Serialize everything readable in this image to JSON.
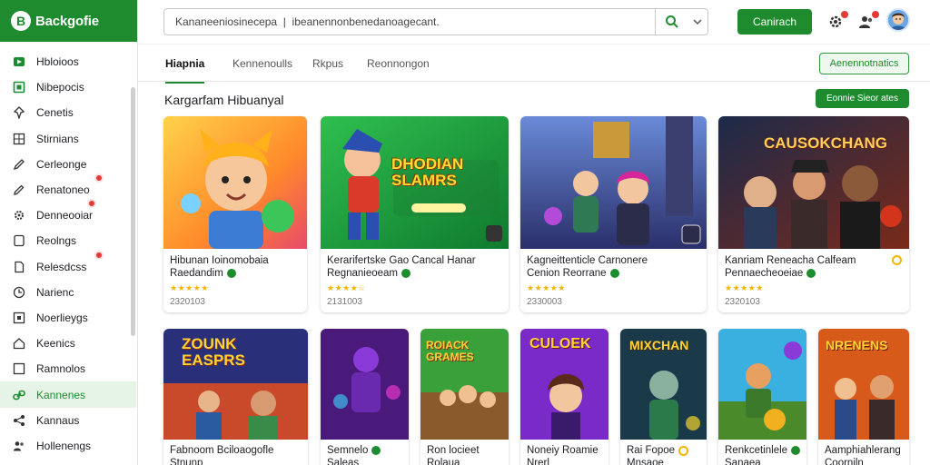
{
  "app": {
    "logo_text": "Backgofie",
    "logo_letter": "B"
  },
  "sidebar": {
    "items": [
      {
        "label": "Hbloioos",
        "icon": "play-icon",
        "active": false,
        "badge": false
      },
      {
        "label": "Nibepocis",
        "icon": "square-play-icon",
        "active": false,
        "badge": false
      },
      {
        "label": "Cenetis",
        "icon": "pin-icon",
        "active": false,
        "badge": false
      },
      {
        "label": "Stirnians",
        "icon": "grid-icon",
        "active": false,
        "badge": false
      },
      {
        "label": "Cerleonge",
        "icon": "pen-icon",
        "active": false,
        "badge": false
      },
      {
        "label": "Renatoneo",
        "icon": "edit-icon",
        "active": false,
        "badge": true
      },
      {
        "label": "Denneooiar",
        "icon": "gear-icon",
        "active": false,
        "badge": true
      },
      {
        "label": "Reolngs",
        "icon": "note-icon",
        "active": false,
        "badge": false
      },
      {
        "label": "Relesdcss",
        "icon": "doc-icon",
        "active": false,
        "badge": true
      },
      {
        "label": "Narienc",
        "icon": "clock-icon",
        "active": false,
        "badge": false
      },
      {
        "label": "Noerlieygs",
        "icon": "box-icon",
        "active": false,
        "badge": false
      },
      {
        "label": "Keenics",
        "icon": "home-icon",
        "active": false,
        "badge": false
      },
      {
        "label": "Ramnolos",
        "icon": "square-icon",
        "active": false,
        "badge": false
      },
      {
        "label": "Kannenes",
        "icon": "link-icon",
        "active": true,
        "badge": false
      },
      {
        "label": "Kannaus",
        "icon": "share-icon",
        "active": false,
        "badge": false
      },
      {
        "label": "Hollenengs",
        "icon": "people-icon",
        "active": false,
        "badge": false
      }
    ]
  },
  "topbar": {
    "search_value": "Kananeeniosinecepa  |  ibeanennonbenedanoagecant.",
    "primary_button": "Canirach"
  },
  "tabs": {
    "items": [
      {
        "label": "Hiapnia",
        "active": true
      },
      {
        "label": "Kennenoulls",
        "active": false
      },
      {
        "label": "Rkpus",
        "active": false
      },
      {
        "label": "Reonnongon",
        "active": false
      }
    ],
    "action_button": "Aenennotnatics"
  },
  "section": {
    "title": "Kargarfam Hibuanyal",
    "button": "Eonnie Sieor ates"
  },
  "row1": [
    {
      "title": "Hibunan Ioinomobaia",
      "sub": "Raedandim",
      "rating": "★★★★★",
      "count": "2320103",
      "banner": ""
    },
    {
      "title": "Kerarifertske Gao Cancal Hanar",
      "sub": "Regnanieoeam",
      "rating": "★★★★☆",
      "count": "2131003",
      "banner": "DHODIAN SLAMRS"
    },
    {
      "title": "Kagneittenticle Carnonere",
      "sub": "Cenion Reorrane",
      "rating": "★★★★★",
      "count": "2330003",
      "banner": ""
    },
    {
      "title": "Kanriam Reneacha Calfeam",
      "sub": "Pennaecheoeiae",
      "rating": "★★★★★",
      "count": "2320103",
      "banner": "CAUSOKCHANG"
    }
  ],
  "row2": [
    {
      "title": "Fabnoom Bciloaogofle",
      "sub": "Stnunp",
      "banner": "ZOUNK EASPRS"
    },
    {
      "title": "Semnelo",
      "sub": "Saleas",
      "banner": ""
    },
    {
      "title": "Ron locieet",
      "sub": "Rolaua",
      "banner": "ROIACK GRAMES"
    },
    {
      "title": "Noneiy Roamie",
      "sub": "Nrerl",
      "banner": "CULOEK"
    },
    {
      "title": "Rai Fopoe",
      "sub": "Mnsaoe",
      "banner": "MIXCHAN"
    },
    {
      "title": "Renkcetinlele",
      "sub": "Sanaea",
      "banner": ""
    },
    {
      "title": "Aamphiahlerang",
      "sub": "Coorniln",
      "banner": "NRENENS"
    }
  ]
}
